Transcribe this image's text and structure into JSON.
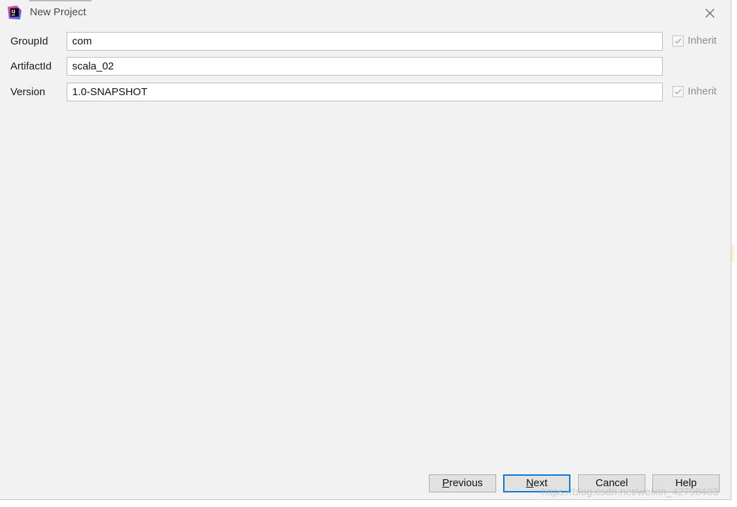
{
  "window": {
    "title": "New Project",
    "icons": {
      "app": "intellij-idea-icon",
      "close": "close-icon"
    }
  },
  "form": {
    "group_id": {
      "label": "GroupId",
      "value": "com",
      "inherit_label": "Inherit",
      "inherit_checked": true
    },
    "artifact_id": {
      "label": "ArtifactId",
      "value": "scala_02"
    },
    "version": {
      "label": "Version",
      "value": "1.0-SNAPSHOT",
      "inherit_label": "Inherit",
      "inherit_checked": true
    }
  },
  "buttons": {
    "previous": {
      "mnemonic": "P",
      "rest": "revious"
    },
    "next": {
      "mnemonic": "N",
      "rest": "ext"
    },
    "cancel": "Cancel",
    "help": "Help"
  },
  "watermark": "https://blog.csdn.net/weixin_42796403",
  "colors": {
    "dialog_bg": "#f2f2f2",
    "default_button_border": "#0a78d7",
    "disabled_text": "#8e8e8e"
  }
}
